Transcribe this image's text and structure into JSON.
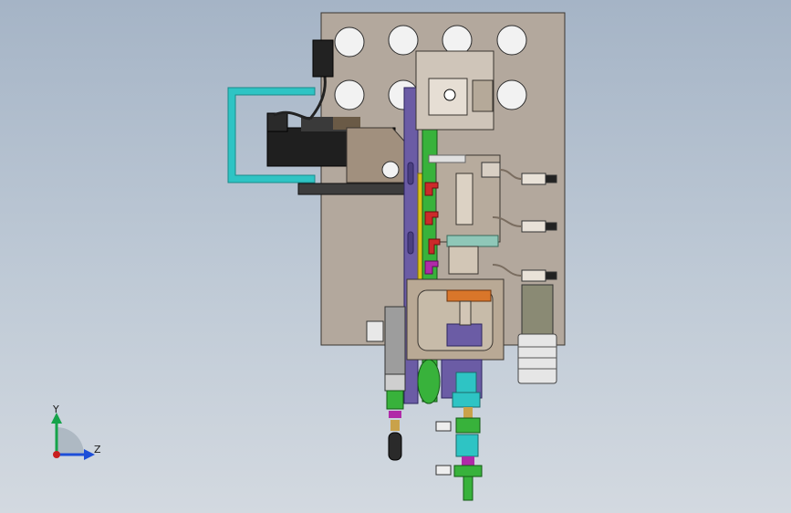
{
  "viewport": {
    "background_top": "#a5b4c6",
    "background_bottom": "#d3d9e0"
  },
  "triad": {
    "y_label": "Y",
    "z_label": "Z",
    "y_color": "#16a34a",
    "z_color": "#1d4ed8",
    "origin_color": "#c81e1e"
  },
  "model": {
    "main_plate_color": "#b3a89d",
    "panel_color": "#a89a8c",
    "motor_color": "#1f1f1f",
    "guard_color": "#2ec4c4",
    "rail_color": "#6b5ca5",
    "green_part_color": "#38b23b",
    "accent_red": "#cc2a2a",
    "accent_magenta": "#b02aa8",
    "accent_yellow": "#d9c21a",
    "accent_orange": "#d9762a",
    "bore_color": "#f2f2f2"
  }
}
